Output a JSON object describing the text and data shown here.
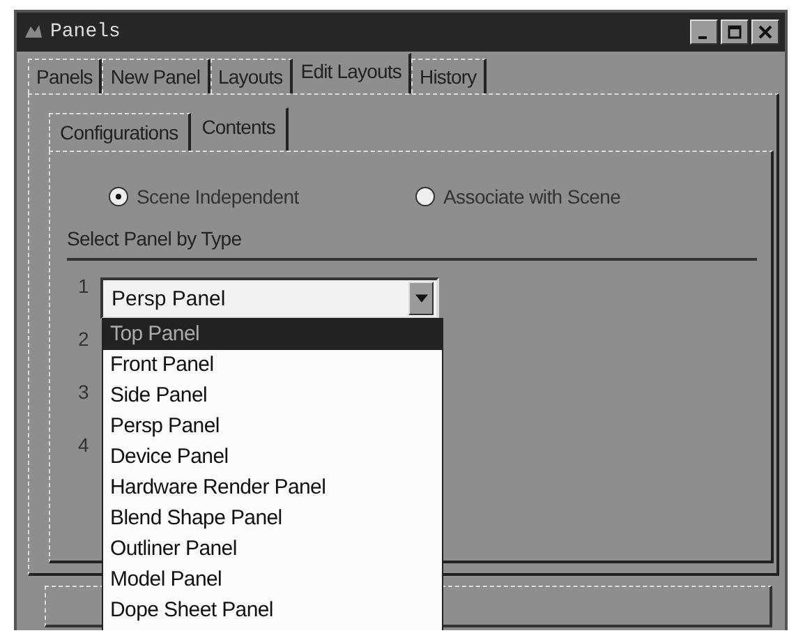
{
  "window": {
    "title": "Panels"
  },
  "tabs": [
    {
      "label": "Panels",
      "selected": false
    },
    {
      "label": "New Panel",
      "selected": false
    },
    {
      "label": "Layouts",
      "selected": false
    },
    {
      "label": "Edit Layouts",
      "selected": true
    },
    {
      "label": "History",
      "selected": false
    }
  ],
  "sub_tabs": [
    {
      "label": "Configurations",
      "selected": false
    },
    {
      "label": "Contents",
      "selected": true
    }
  ],
  "scene_options": [
    {
      "label": "Scene Independent",
      "selected": true
    },
    {
      "label": "Associate with Scene",
      "selected": false
    }
  ],
  "section_label": "Select Panel by Type",
  "panel_rows": [
    {
      "number": "1",
      "value": "Persp Panel"
    },
    {
      "number": "2"
    },
    {
      "number": "3"
    },
    {
      "number": "4"
    }
  ],
  "dropdown": {
    "items": [
      {
        "label": "Top Panel",
        "selected": true
      },
      {
        "label": "Front Panel",
        "selected": false
      },
      {
        "label": "Side Panel",
        "selected": false
      },
      {
        "label": "Persp Panel",
        "selected": false
      },
      {
        "label": "Device Panel",
        "selected": false
      },
      {
        "label": "Hardware Render Panel",
        "selected": false
      },
      {
        "label": "Blend Shape Panel",
        "selected": false
      },
      {
        "label": "Outliner Panel",
        "selected": false
      },
      {
        "label": "Model Panel",
        "selected": false
      },
      {
        "label": "Dope Sheet Panel",
        "selected": false
      }
    ]
  }
}
